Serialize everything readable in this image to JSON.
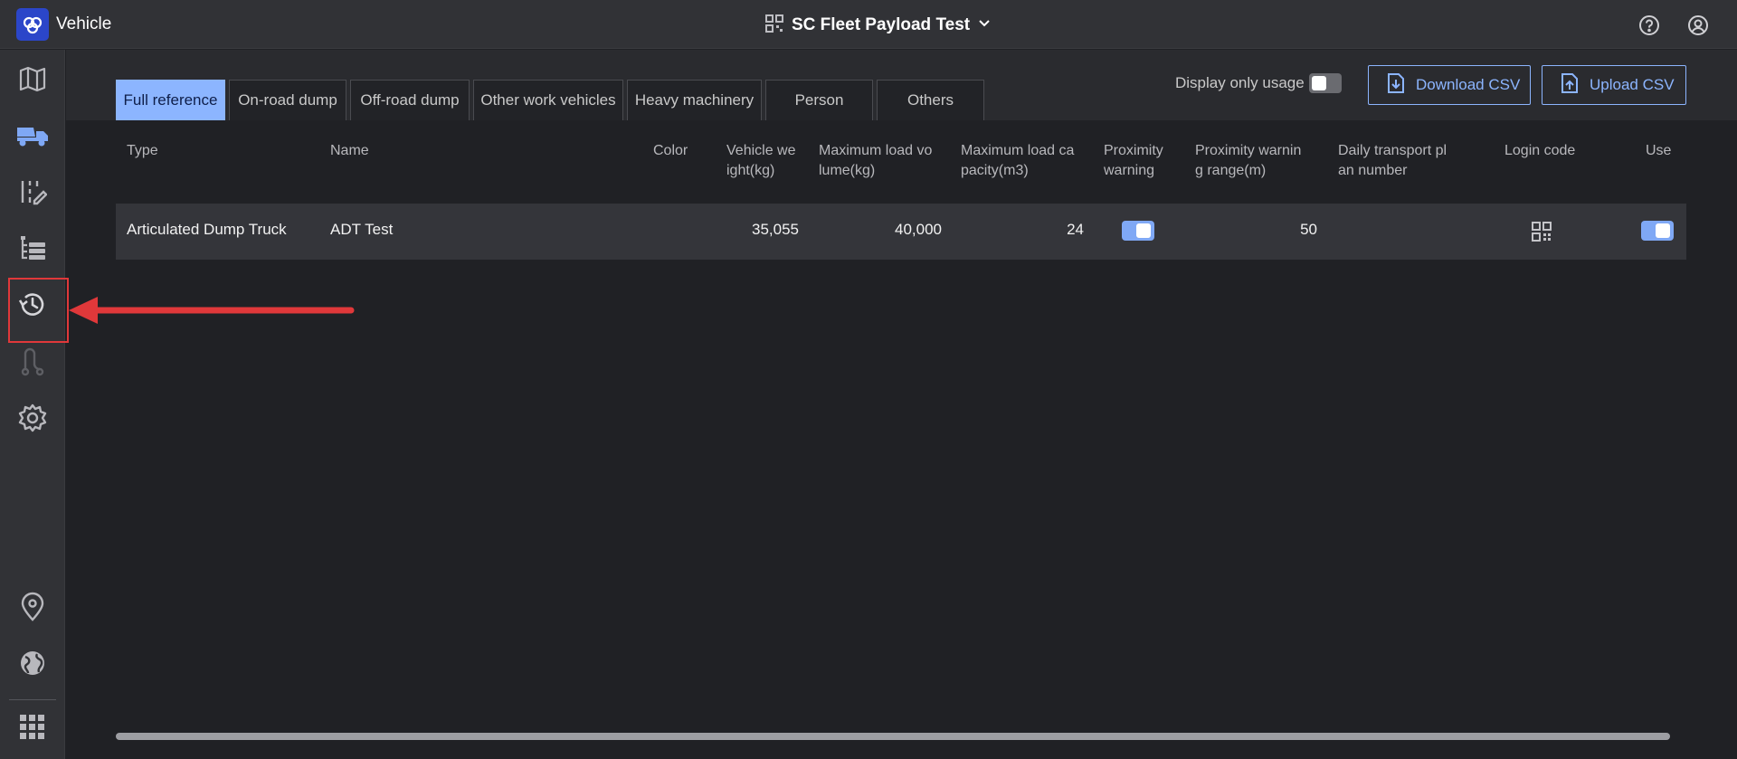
{
  "header": {
    "app_title": "Vehicle",
    "project_name": "SC Fleet Payload Test",
    "icons": [
      "app-logo-icon",
      "qr-code-icon",
      "chevron-down-icon",
      "help-icon",
      "user-account-icon"
    ]
  },
  "sidebar": {
    "items": [
      {
        "name": "map",
        "icon": "map-icon"
      },
      {
        "name": "vehicle",
        "icon": "dump-truck-icon",
        "active": true
      },
      {
        "name": "plan-edit",
        "icon": "plan-edit-icon"
      },
      {
        "name": "list",
        "icon": "list-tree-icon"
      },
      {
        "name": "history",
        "icon": "history-icon",
        "highlighted": true
      },
      {
        "name": "route",
        "icon": "route-icon",
        "disabled": true
      },
      {
        "name": "settings",
        "icon": "gear-icon"
      },
      {
        "name": "location",
        "icon": "location-pin-icon"
      },
      {
        "name": "globe",
        "icon": "globe-icon"
      },
      {
        "name": "apps",
        "icon": "apps-grid-icon"
      }
    ]
  },
  "tabs": [
    {
      "label": "Full reference",
      "active": true
    },
    {
      "label": "On-road dump"
    },
    {
      "label": "Off-road dump"
    },
    {
      "label": "Other work vehicles"
    },
    {
      "label": "Heavy machinery"
    },
    {
      "label": "Person"
    },
    {
      "label": "Others"
    }
  ],
  "toolbar": {
    "display_only_usage_label": "Display only usage",
    "display_only_usage_on": false,
    "download_csv_label": "Download CSV",
    "upload_csv_label": "Upload CSV"
  },
  "table": {
    "columns": [
      {
        "key": "type",
        "label": "Type"
      },
      {
        "key": "name",
        "label": "Name"
      },
      {
        "key": "color",
        "label": "Color"
      },
      {
        "key": "vehicle_weight",
        "label_1": "Vehicle we",
        "label_2": "ight(kg)"
      },
      {
        "key": "max_load_volume",
        "label_1": "Maximum load vo",
        "label_2": "lume(kg)"
      },
      {
        "key": "max_load_capacity",
        "label_1": "Maximum load ca",
        "label_2": "pacity(m3)"
      },
      {
        "key": "proximity_warning",
        "label_1": "Proximity",
        "label_2": "warning"
      },
      {
        "key": "proximity_range",
        "label_1": "Proximity warnin",
        "label_2": "g range(m)"
      },
      {
        "key": "daily_plan_number",
        "label_1": "Daily transport pl",
        "label_2": "an number"
      },
      {
        "key": "login_code",
        "label": "Login code"
      },
      {
        "key": "use",
        "label": "Use"
      }
    ],
    "rows": [
      {
        "type": "Articulated Dump Truck",
        "name": "ADT Test",
        "color": "",
        "vehicle_weight": "35,055",
        "max_load_volume": "40,000",
        "max_load_capacity": "24",
        "proximity_warning": true,
        "proximity_range": "50",
        "daily_plan_number": "",
        "login_code_icon": "qr-code-icon",
        "use": true
      }
    ]
  },
  "colors": {
    "accent": "#8cb5ff",
    "toggle_on": "#7fa8f5",
    "annotation": "#e0383a",
    "background": "#202125",
    "panel": "#313236"
  }
}
